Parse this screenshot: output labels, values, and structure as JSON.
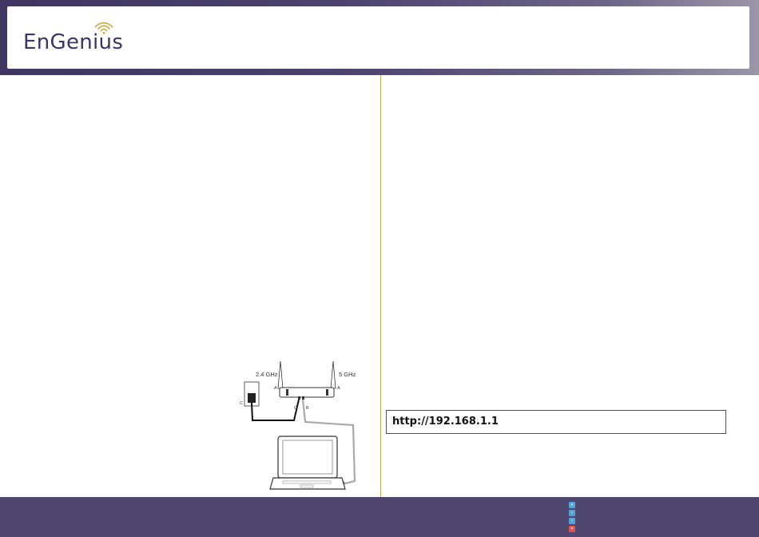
{
  "header": {
    "logo_text": "EnGenius"
  },
  "diagram": {
    "band_left": "2.4 GHz",
    "band_right": "5 GHz",
    "label_a": "A",
    "label_b": "B",
    "label_c": "C"
  },
  "url_box": {
    "text": "http://192.168.1.1"
  },
  "footer": {
    "nav_icons": [
      "first-page-icon",
      "previous-page-icon",
      "next-page-icon",
      "close-icon"
    ]
  }
}
